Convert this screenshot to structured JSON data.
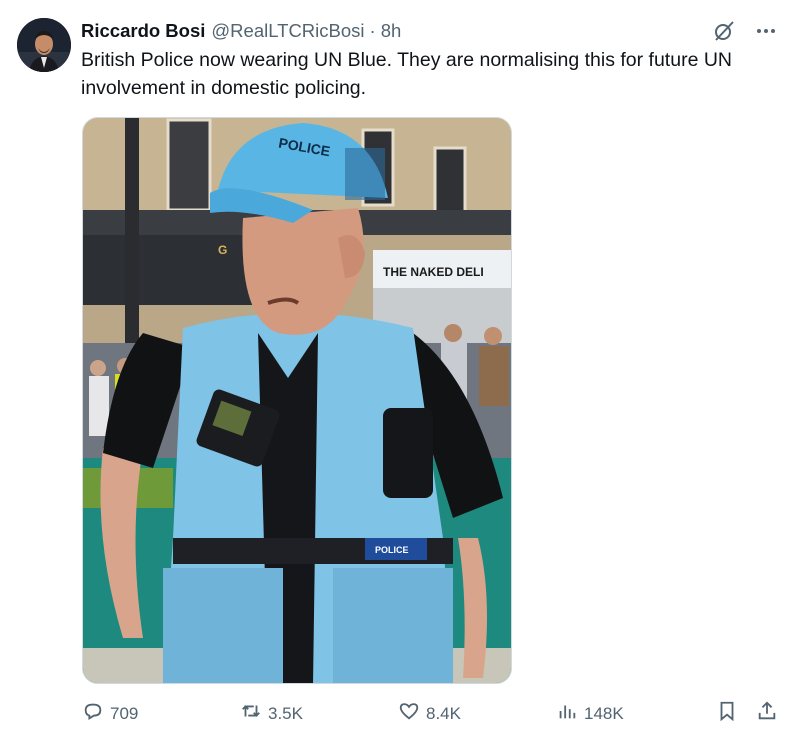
{
  "author": {
    "name": "Riccardo Bosi",
    "handle": "@RealLTCRicBosi",
    "separator": "·",
    "time": "8h"
  },
  "tweet": {
    "text": "British Police now wearing UN Blue. They are normalising this for future UN involvement in domestic policing."
  },
  "media": {
    "cap_text": "POLICE",
    "shop_sign": "THE NAKED DELI",
    "shop_sign_left": "G",
    "vest_badge": "POLICE"
  },
  "actions": {
    "replies": "709",
    "reposts": "3.5K",
    "likes": "8.4K",
    "views": "148K"
  },
  "icons": {
    "grok": "grok-slash-icon",
    "more": "more-dots-icon",
    "reply": "reply-icon",
    "repost": "repost-icon",
    "like": "heart-icon",
    "views": "views-chart-icon",
    "bookmark": "bookmark-icon",
    "share": "share-icon"
  },
  "colors": {
    "text_primary": "#0f1419",
    "text_secondary": "#536471",
    "vest_blue": "#7fc3e6"
  }
}
